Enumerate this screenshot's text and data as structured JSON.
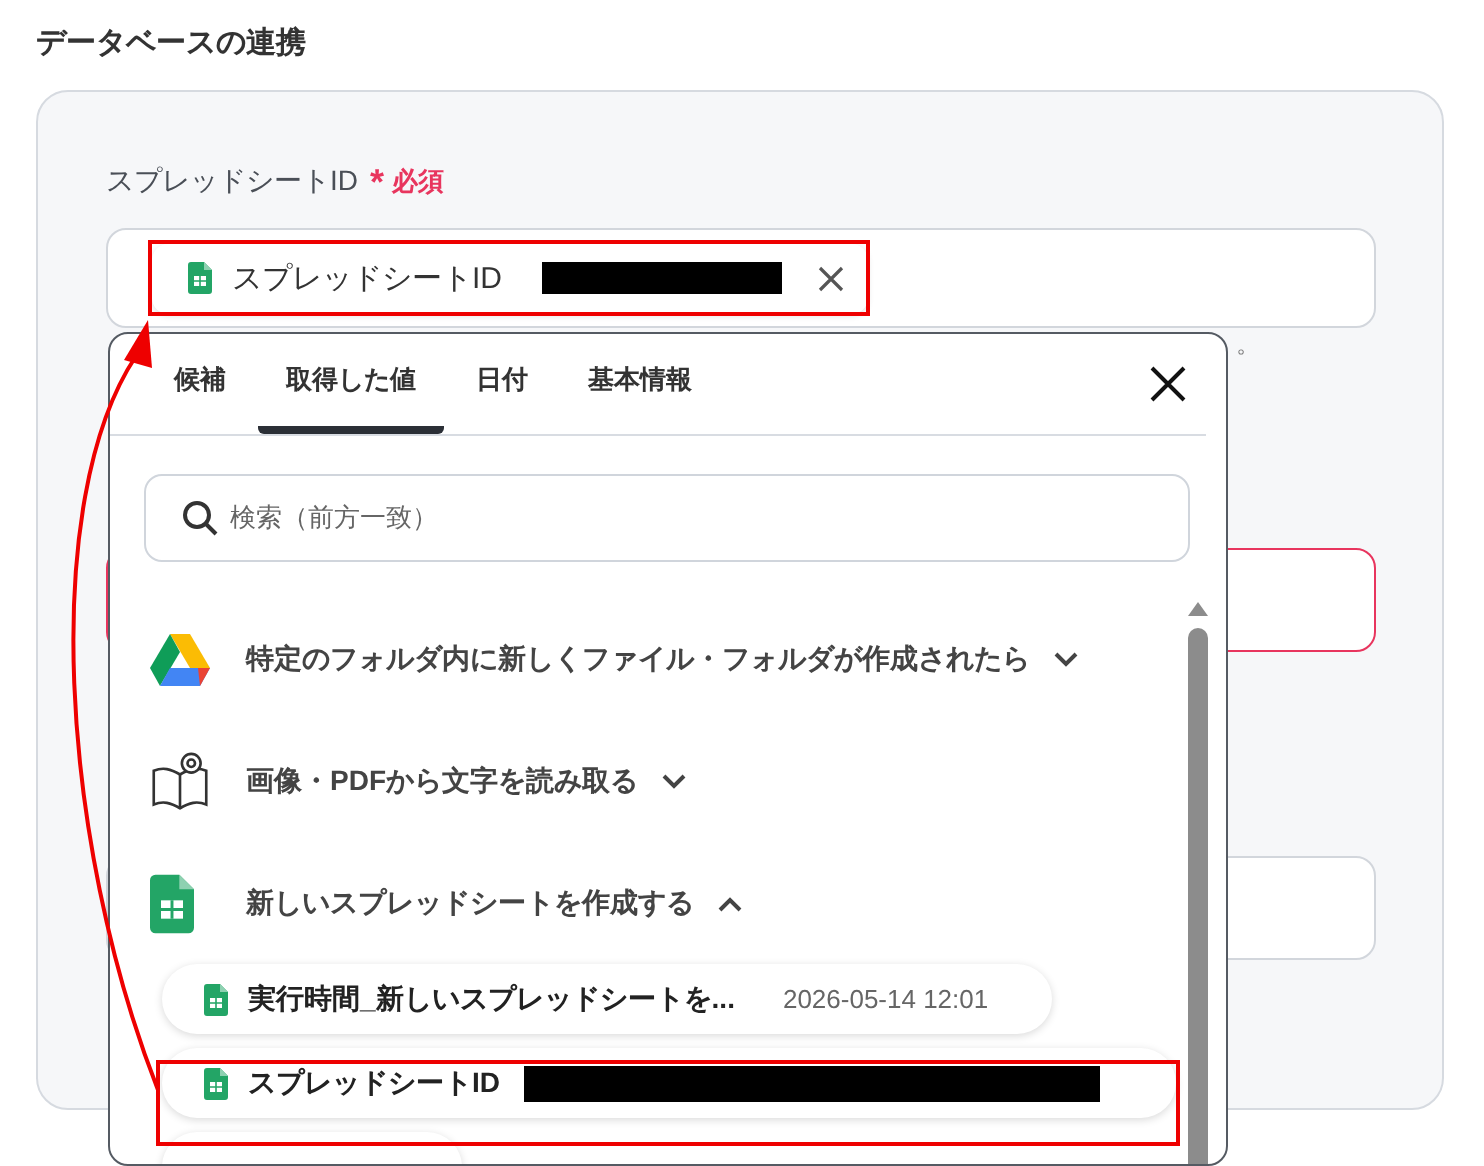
{
  "section_title": "データベースの連携",
  "field": {
    "label": "スプレッドシートID",
    "required_mark": "*",
    "required_text": "必須",
    "token": {
      "label": "スプレッドシートID"
    }
  },
  "helper_text_fragment": "。",
  "picker": {
    "tabs": [
      {
        "label": "候補",
        "selected": false
      },
      {
        "label": "取得した値",
        "selected": true
      },
      {
        "label": "日付",
        "selected": false
      },
      {
        "label": "基本情報",
        "selected": false
      }
    ],
    "search": {
      "placeholder": "検索（前方一致）"
    },
    "groups": [
      {
        "kind": "drive",
        "title": "特定のフォルダ内に新しくファイル・フォルダが作成されたら",
        "expanded": false
      },
      {
        "kind": "ocr",
        "title": "画像・PDFから文字を読み取る",
        "expanded": false
      },
      {
        "kind": "sheets",
        "title": "新しいスプレッドシートを作成する",
        "expanded": true,
        "items": [
          {
            "label": "実行時間_新しいスプレッドシートを...",
            "time": "2026-05-14 12:01",
            "highlighted": false
          },
          {
            "label": "スプレッドシートID",
            "highlighted": true
          }
        ]
      }
    ]
  }
}
